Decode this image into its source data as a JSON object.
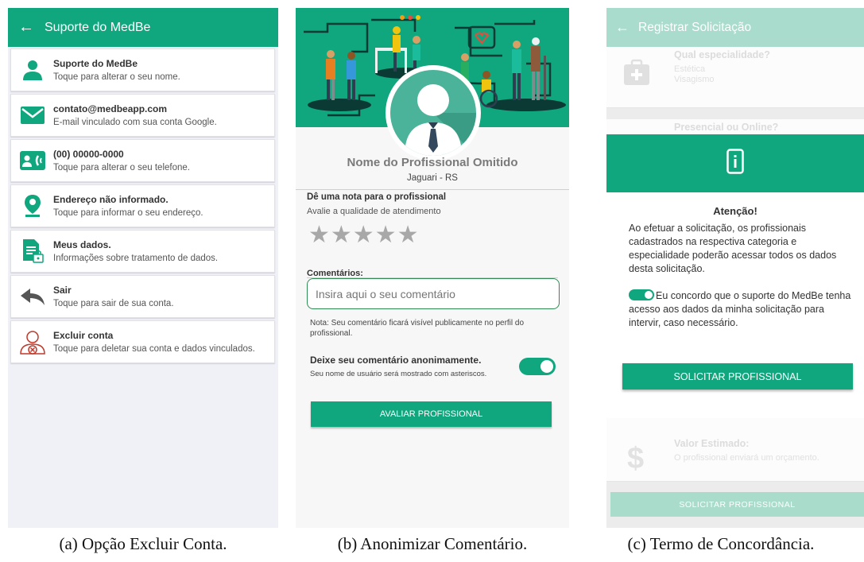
{
  "panel_a": {
    "title": "Suporte do MedBe",
    "back_icon": "arrow-left-icon",
    "items": [
      {
        "icon": "person-icon",
        "title": "Suporte do MedBe",
        "subtitle": "Toque para alterar o seu nome."
      },
      {
        "icon": "mail-icon",
        "title": "contato@medbeapp.com",
        "subtitle": "E-mail vinculado com sua conta Google."
      },
      {
        "icon": "contact-phone-icon",
        "title": "(00) 00000-0000",
        "subtitle": "Toque para alterar o seu telefone."
      },
      {
        "icon": "location-pin-icon",
        "title": "Endereço não informado.",
        "subtitle": "Toque para informar o seu endereço."
      },
      {
        "icon": "document-lock-icon",
        "title": "Meus dados.",
        "subtitle": "Informações sobre tratamento de dados."
      },
      {
        "icon": "reply-arrow-icon",
        "title": "Sair",
        "subtitle": "Toque para sair de sua conta."
      },
      {
        "icon": "delete-user-icon",
        "title": "Excluir conta",
        "subtitle": "Toque para deletar sua conta e dados vinculados."
      }
    ],
    "caption": "(a) Opção Excluir Conta."
  },
  "panel_b": {
    "professional_name": "Nome do Profissional Omitido",
    "city": "Jaguari - RS",
    "rating_title": "Dê uma nota para o profissional",
    "rating_subtitle": "Avalie a qualidade de atendimento",
    "stars": "★★★★★",
    "comments_label": "Comentários:",
    "comment_placeholder": "Insira aqui o seu comentário",
    "comment_value": "",
    "note": "Nota: Seu comentário ficará visível publicamente no perfil do profissional.",
    "anon_title": "Deixe seu comentário anonimamente.",
    "anon_subtitle": "Seu nome de usuário será mostrado com asteriscos.",
    "anon_enabled": true,
    "submit_label": "AVALIAR PROFISSIONAL",
    "caption": "(b) Anonimizar Comentário."
  },
  "panel_c": {
    "title": "Registrar Solicitação",
    "back_icon": "arrow-left-icon",
    "specialty_title": "Qual especialidade?",
    "specialty_line1": "Estética",
    "specialty_line2": "Visagismo",
    "mode_title": "Presencial ou Online?",
    "price_title": "Valor Estimado:",
    "price_subtitle": "O profissional enviará um orçamento.",
    "modal_title": "Atenção!",
    "modal_body": "Ao efetuar a solicitação, os profissionais cadastrados na respectiva categoria e especialidade poderão acessar todos os dados desta solicitação.",
    "agree_text": "Eu concordo que o suporte do MedBe tenha acesso aos dados da minha solicitação para intervir, caso necessário.",
    "agree_enabled": true,
    "modal_button": "SOLICITAR PROFISSIONAL",
    "bottom_button": "SOLICITAR PROFISSIONAL",
    "caption": "(c) Termo de Concordância."
  },
  "colors": {
    "primary": "#10a67e",
    "primary_faded": "#a9dccc",
    "danger": "#c0392b"
  }
}
